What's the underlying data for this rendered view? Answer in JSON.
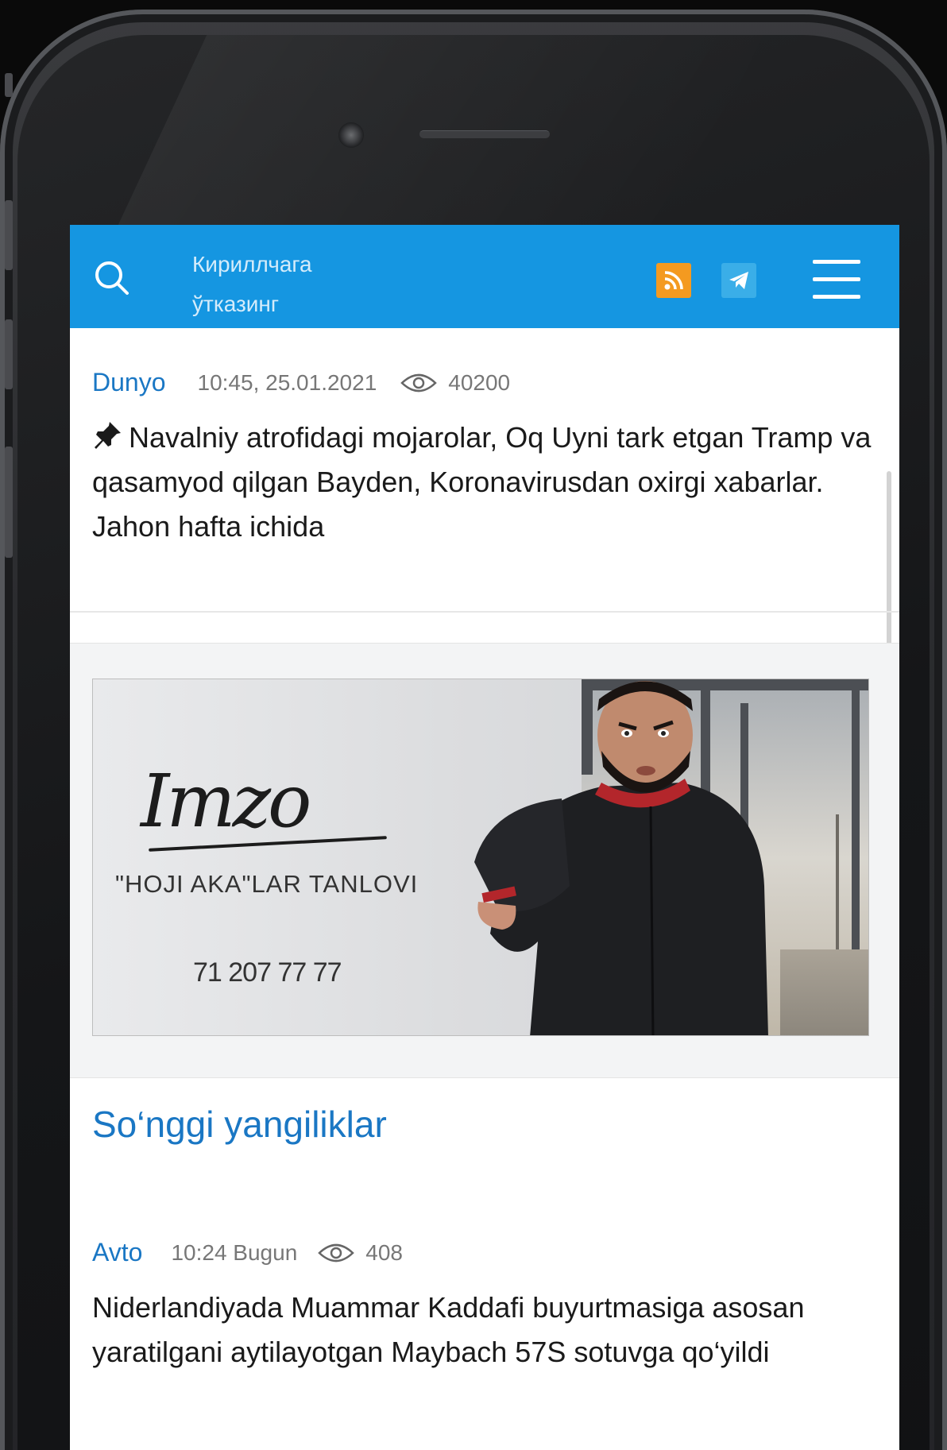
{
  "header": {
    "search_icon": "search-icon",
    "translit_label": "Кириллчага ўтказинг",
    "rss_icon": "rss-icon",
    "telegram_icon": "telegram-icon",
    "menu_icon": "hamburger-menu-icon",
    "bar_color": "#1596E1"
  },
  "featured": {
    "category": "Dunyo",
    "time": "10:45, 25.01.2021",
    "views": "40200",
    "pin_icon": "pin-icon",
    "title": "Navalniy atrofidagi mojarolar, Oq Uyni tark etgan Tramp va qasamyod qilgan Bayden, Koronavirusdan oxirgi xabarlar. Jahon hafta ichida"
  },
  "ad": {
    "logo": "Imzo",
    "slogan": "\"HOJI AKA\"LAR TANLOVI",
    "phone": "71 207 77 77"
  },
  "latest": {
    "section_title": "So‘nggi yangiliklar",
    "items": [
      {
        "category": "Avto",
        "time": "10:24 Bugun",
        "views": "408",
        "title": "Niderlandiyada Muammar Kaddafi buyurtmasiga asosan yaratilgani aytilayotgan Maybach 57S sotuvga qo‘yildi"
      }
    ]
  }
}
